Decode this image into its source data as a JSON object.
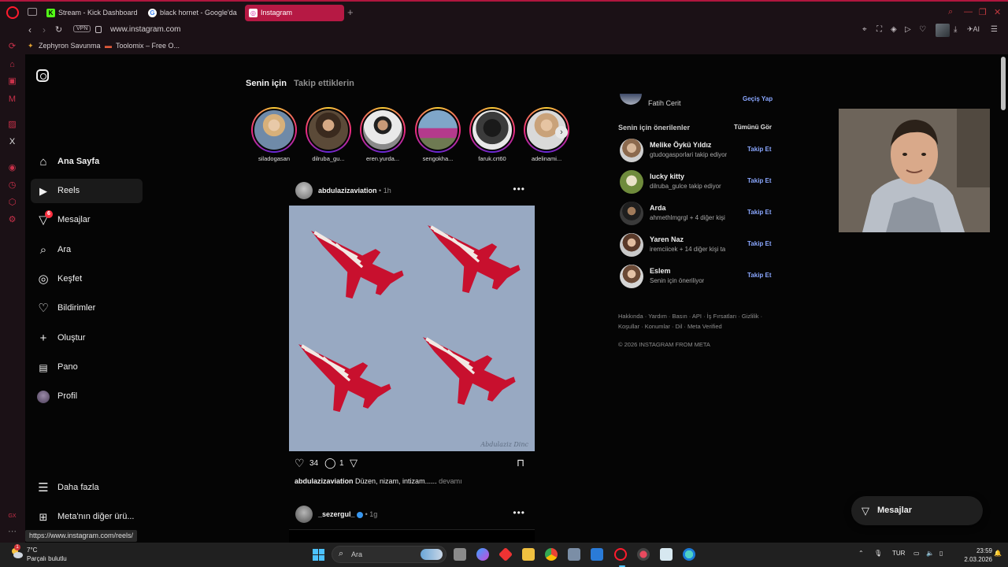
{
  "browser": {
    "tabs": [
      {
        "label": "Stream - Kick Dashboard",
        "favicon": "K"
      },
      {
        "label": "black hornet - Google'da Ara",
        "favicon": "G"
      },
      {
        "label": "Instagram",
        "favicon": "◎"
      }
    ],
    "vpn_label": "VPN",
    "url": "www.instagram.com",
    "ai_label": "AI",
    "bookmarks": [
      {
        "label": "Zephyron Savunma"
      },
      {
        "label": "Toolomix – Free O..."
      }
    ],
    "accent_color": "#b61944"
  },
  "instagram": {
    "nav": [
      {
        "label": "Ana Sayfa",
        "icon": "home-icon"
      },
      {
        "label": "Reels",
        "icon": "reels-icon"
      },
      {
        "label": "Mesajlar",
        "icon": "messages-icon",
        "badge": "6"
      },
      {
        "label": "Ara",
        "icon": "search-icon"
      },
      {
        "label": "Keşfet",
        "icon": "explore-icon"
      },
      {
        "label": "Bildirimler",
        "icon": "heart-icon"
      },
      {
        "label": "Oluştur",
        "icon": "plus-icon"
      },
      {
        "label": "Pano",
        "icon": "dashboard-icon"
      },
      {
        "label": "Profil",
        "icon": "profile-avatar"
      }
    ],
    "more_label": "Daha fazla",
    "meta_label": "Meta'nın diğer ürü...",
    "feed_tabs": {
      "for_you": "Senin için",
      "following": "Takip ettiklerin"
    },
    "stories": [
      {
        "user": "siladogasan"
      },
      {
        "user": "dilruba_gu..."
      },
      {
        "user": "eren.yurda..."
      },
      {
        "user": "sengokha..."
      },
      {
        "user": "faruk.crt60"
      },
      {
        "user": "adelinami..."
      }
    ],
    "post1": {
      "user": "abdulazizaviation",
      "time": "1h",
      "likes": "34",
      "comments": "1",
      "caption_user": "abdulazizaviation",
      "caption_text": "Düzen, nizam, intizam......",
      "more": "devamı",
      "signature": "Abdulaziz Dinc"
    },
    "post2": {
      "user": "_sezergul_",
      "time": "1g"
    },
    "right": {
      "current_user": "Fatih Cerit",
      "switch_label": "Geçiş Yap",
      "suggestions_title": "Senin için önerilenler",
      "see_all": "Tümünü Gör",
      "suggestions": [
        {
          "name": "Melike Öykü Yıldız",
          "sub": "gtudogasporlari takip ediyor",
          "follow": "Takip Et"
        },
        {
          "name": "lucky kitty",
          "sub": "dilruba_gulce takip ediyor",
          "follow": "Takip Et"
        },
        {
          "name": "Arda",
          "sub": "ahmethlmgrgl + 4 diğer kişi",
          "follow": "Takip Et"
        },
        {
          "name": "Yaren Naz",
          "sub": "iremciicek + 14 diğer kişi ta",
          "follow": "Takip Et"
        },
        {
          "name": "Eslem",
          "sub": "Senin için öneriliyor",
          "follow": "Takip Et"
        }
      ],
      "footer_line1": "Hakkında · Yardım · Basın · API · İş Fırsatları · Gizlilik ·",
      "footer_line2": "Koşullar · Konumlar · Dil · Meta Verified",
      "copyright": "© 2026 INSTAGRAM FROM META"
    },
    "messages_pill": "Mesajlar"
  },
  "status_url": "https://www.instagram.com/reels/",
  "taskbar": {
    "temp": "7°C",
    "weather": "Parçalı bulutlu",
    "weather_badge": "1",
    "search_placeholder": "Ara",
    "lang": "TUR",
    "time": "23:59",
    "date": "2.03.2026"
  }
}
